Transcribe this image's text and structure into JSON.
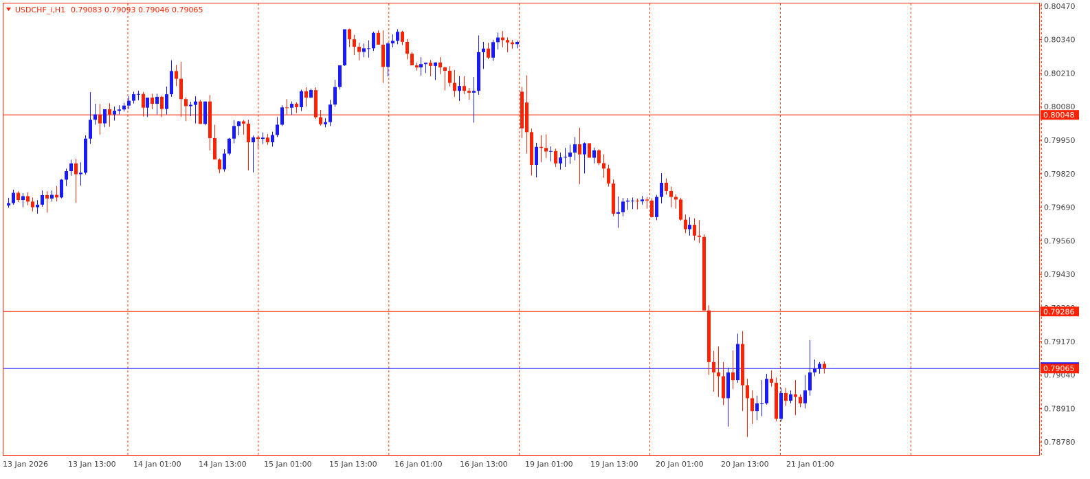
{
  "header": {
    "symbol": "USDCHF_i,H1",
    "ohlc": "0.79083 0.79093 0.79046 0.79065"
  },
  "colors": {
    "frame": "#ff2200",
    "bull": "#1a1aff",
    "bear": "#ff2200",
    "grid": "#ff3300",
    "level_line": "#ff2200",
    "bid_line": "#1a1aff",
    "tag_level": "#ff2200",
    "tag_bid": "#ff2200",
    "background": "#ffffff"
  },
  "chart_data": {
    "type": "candlestick",
    "timeframe": "H1",
    "ylim": [
      0.7873,
      0.8048
    ],
    "y_ticks": [
      "0.80470",
      "0.80340",
      "0.80210",
      "0.80080",
      "0.79950",
      "0.79820",
      "0.79690",
      "0.79560",
      "0.79430",
      "0.79300",
      "0.79170",
      "0.79040",
      "0.78910",
      "0.78780"
    ],
    "x_ticks": [
      "13 Jan 2026",
      "13 Jan 13:00",
      "14 Jan 01:00",
      "14 Jan 13:00",
      "15 Jan 01:00",
      "15 Jan 13:00",
      "16 Jan 01:00",
      "16 Jan 13:00",
      "19 Jan 01:00",
      "19 Jan 13:00",
      "20 Jan 01:00",
      "20 Jan 13:00",
      "21 Jan 01:00"
    ],
    "horizontal_levels": [
      {
        "price": 0.80048,
        "label": "0.80048"
      },
      {
        "price": 0.79286,
        "label": "0.79286"
      }
    ],
    "bid": {
      "price": 0.79065,
      "label": "0.79065"
    },
    "grid": "vertical dashed",
    "candles": [
      [
        0.79697,
        0.79727,
        0.79688,
        0.79706
      ],
      [
        0.79706,
        0.79758,
        0.797,
        0.79746
      ],
      [
        0.79746,
        0.79752,
        0.7971,
        0.79718
      ],
      [
        0.79718,
        0.79745,
        0.7969,
        0.79733
      ],
      [
        0.79733,
        0.79748,
        0.79698,
        0.79712
      ],
      [
        0.79712,
        0.79728,
        0.79674,
        0.7969
      ],
      [
        0.7969,
        0.79718,
        0.79665,
        0.797
      ],
      [
        0.797,
        0.79755,
        0.79692,
        0.79737
      ],
      [
        0.79737,
        0.79752,
        0.79669,
        0.79724
      ],
      [
        0.79724,
        0.79755,
        0.79712,
        0.79738
      ],
      [
        0.79738,
        0.79772,
        0.79713,
        0.79728
      ],
      [
        0.79728,
        0.79799,
        0.79725,
        0.79797
      ],
      [
        0.79797,
        0.7984,
        0.79772,
        0.7983
      ],
      [
        0.7983,
        0.79874,
        0.79812,
        0.7986
      ],
      [
        0.7986,
        0.79878,
        0.79707,
        0.79818
      ],
      [
        0.79818,
        0.79864,
        0.79774,
        0.79824
      ],
      [
        0.79824,
        0.79969,
        0.79817,
        0.79956
      ],
      [
        0.79956,
        0.80136,
        0.79936,
        0.80029
      ],
      [
        0.80029,
        0.80091,
        0.8001,
        0.8005
      ],
      [
        0.8005,
        0.8009,
        0.79972,
        0.80015
      ],
      [
        0.80015,
        0.80061,
        0.8,
        0.8007
      ],
      [
        0.8007,
        0.80093,
        0.80002,
        0.8005
      ],
      [
        0.8005,
        0.8008,
        0.80026,
        0.80064
      ],
      [
        0.80064,
        0.80085,
        0.8005,
        0.80069
      ],
      [
        0.80069,
        0.80095,
        0.80061,
        0.80084
      ],
      [
        0.80084,
        0.8012,
        0.8007,
        0.80103
      ],
      [
        0.80103,
        0.80138,
        0.80092,
        0.80128
      ],
      [
        0.80128,
        0.80142,
        0.80105,
        0.80129
      ],
      [
        0.80129,
        0.80137,
        0.80042,
        0.80076
      ],
      [
        0.80076,
        0.8011,
        0.8004,
        0.80115
      ],
      [
        0.80115,
        0.8013,
        0.8007,
        0.80091
      ],
      [
        0.80091,
        0.8013,
        0.8005,
        0.80118
      ],
      [
        0.80118,
        0.80122,
        0.8004,
        0.80071
      ],
      [
        0.80071,
        0.80158,
        0.8005,
        0.80128
      ],
      [
        0.80128,
        0.8026,
        0.80118,
        0.80218
      ],
      [
        0.80218,
        0.80241,
        0.80159,
        0.80188
      ],
      [
        0.80188,
        0.80254,
        0.80041,
        0.80109
      ],
      [
        0.80109,
        0.80116,
        0.80024,
        0.80082
      ],
      [
        0.80082,
        0.80099,
        0.80043,
        0.80087
      ],
      [
        0.80087,
        0.8012,
        0.80015,
        0.801
      ],
      [
        0.801,
        0.80106,
        0.80028,
        0.80013
      ],
      [
        0.80013,
        0.801,
        0.80008,
        0.801
      ],
      [
        0.801,
        0.80125,
        0.7991,
        0.79958
      ],
      [
        0.79958,
        0.8001,
        0.79921,
        0.79875
      ],
      [
        0.79875,
        0.79879,
        0.79822,
        0.79837
      ],
      [
        0.79837,
        0.79915,
        0.79828,
        0.79898
      ],
      [
        0.79898,
        0.79959,
        0.79891,
        0.79956
      ],
      [
        0.79956,
        0.80028,
        0.79938,
        0.80005
      ],
      [
        0.80005,
        0.80025,
        0.79969,
        0.80023
      ],
      [
        0.80023,
        0.80028,
        0.79972,
        0.80014
      ],
      [
        0.80014,
        0.80029,
        0.79833,
        0.79942
      ],
      [
        0.79942,
        0.79968,
        0.79825,
        0.79961
      ],
      [
        0.79961,
        0.79967,
        0.79917,
        0.79955
      ],
      [
        0.79955,
        0.7998,
        0.79935,
        0.7996
      ],
      [
        0.7996,
        0.79974,
        0.79932,
        0.79942
      ],
      [
        0.79942,
        0.79983,
        0.79925,
        0.7997
      ],
      [
        0.7997,
        0.8004,
        0.79962,
        0.8001
      ],
      [
        0.8001,
        0.80085,
        0.80005,
        0.80077
      ],
      [
        0.80077,
        0.80109,
        0.8005,
        0.80076
      ],
      [
        0.80076,
        0.801,
        0.80048,
        0.80091
      ],
      [
        0.80091,
        0.80097,
        0.80055,
        0.80078
      ],
      [
        0.80078,
        0.80146,
        0.80063,
        0.8014
      ],
      [
        0.8014,
        0.80155,
        0.8008,
        0.80115
      ],
      [
        0.80115,
        0.8015,
        0.80125,
        0.80144
      ],
      [
        0.80144,
        0.80155,
        0.80033,
        0.80039
      ],
      [
        0.80039,
        0.80067,
        0.80007,
        0.80012
      ],
      [
        0.80012,
        0.80036,
        0.8,
        0.8002
      ],
      [
        0.8002,
        0.80106,
        0.80005,
        0.80088
      ],
      [
        0.80088,
        0.80184,
        0.80079,
        0.80156
      ],
      [
        0.80156,
        0.8022,
        0.80146,
        0.8024
      ],
      [
        0.8024,
        0.80348,
        0.80238,
        0.8038
      ],
      [
        0.8038,
        0.80382,
        0.80311,
        0.80341
      ],
      [
        0.80341,
        0.80358,
        0.8028,
        0.80312
      ],
      [
        0.80312,
        0.80328,
        0.8026,
        0.80292
      ],
      [
        0.80292,
        0.80325,
        0.80272,
        0.80306
      ],
      [
        0.80306,
        0.80337,
        0.8027,
        0.80306
      ],
      [
        0.80306,
        0.8037,
        0.80296,
        0.80366
      ],
      [
        0.80366,
        0.80375,
        0.80323,
        0.8032
      ],
      [
        0.8032,
        0.80375,
        0.80172,
        0.80234
      ],
      [
        0.80234,
        0.8033,
        0.80197,
        0.80325
      ],
      [
        0.80325,
        0.8036,
        0.8031,
        0.80335
      ],
      [
        0.80335,
        0.8038,
        0.80322,
        0.8037
      ],
      [
        0.8037,
        0.80374,
        0.80319,
        0.80331
      ],
      [
        0.80331,
        0.80342,
        0.80263,
        0.80285
      ],
      [
        0.80285,
        0.80292,
        0.80241,
        0.8024
      ],
      [
        0.8024,
        0.8025,
        0.8022,
        0.80232
      ],
      [
        0.80232,
        0.80272,
        0.802,
        0.80245
      ],
      [
        0.80245,
        0.8025,
        0.8021,
        0.8025
      ],
      [
        0.8025,
        0.80261,
        0.80198,
        0.80238
      ],
      [
        0.80238,
        0.80252,
        0.80183,
        0.80251
      ],
      [
        0.80251,
        0.80272,
        0.80206,
        0.80232
      ],
      [
        0.80232,
        0.80235,
        0.80143,
        0.80219
      ],
      [
        0.80219,
        0.80237,
        0.80158,
        0.80172
      ],
      [
        0.80172,
        0.80222,
        0.80118,
        0.80141
      ],
      [
        0.80141,
        0.80198,
        0.80102,
        0.8016
      ],
      [
        0.8016,
        0.80198,
        0.80129,
        0.80141
      ],
      [
        0.80141,
        0.80152,
        0.80106,
        0.80134
      ],
      [
        0.80134,
        0.80195,
        0.80018,
        0.80141
      ],
      [
        0.80141,
        0.80356,
        0.80126,
        0.80291
      ],
      [
        0.80291,
        0.80331,
        0.80226,
        0.80305
      ],
      [
        0.80305,
        0.80327,
        0.80264,
        0.8027
      ],
      [
        0.8027,
        0.80339,
        0.80257,
        0.8033
      ],
      [
        0.8033,
        0.80367,
        0.80302,
        0.80348
      ],
      [
        0.80348,
        0.80373,
        0.8031,
        0.80338
      ],
      [
        0.80338,
        0.80348,
        0.80291,
        0.80329
      ],
      [
        0.80329,
        0.80339,
        0.80305,
        0.80322
      ],
      [
        0.80322,
        0.80336,
        0.80306,
        0.80331
      ],
      [
        0.80138,
        0.80157,
        0.79958,
        0.79996
      ],
      [
        0.80096,
        0.80201,
        0.79898,
        0.79981
      ],
      [
        0.79981,
        0.79995,
        0.79813,
        0.79854
      ],
      [
        0.79854,
        0.7994,
        0.79806,
        0.79924
      ],
      [
        0.79924,
        0.79969,
        0.79865,
        0.7992
      ],
      [
        0.7992,
        0.79973,
        0.79881,
        0.79906
      ],
      [
        0.79906,
        0.79926,
        0.79868,
        0.79908
      ],
      [
        0.79908,
        0.79917,
        0.79846,
        0.7986
      ],
      [
        0.7986,
        0.79902,
        0.79836,
        0.79883
      ],
      [
        0.79883,
        0.7992,
        0.79846,
        0.79886
      ],
      [
        0.79886,
        0.79933,
        0.79858,
        0.79902
      ],
      [
        0.79902,
        0.79962,
        0.79872,
        0.79934
      ],
      [
        0.79934,
        0.79998,
        0.7978,
        0.79895
      ],
      [
        0.79895,
        0.79941,
        0.79821,
        0.79938
      ],
      [
        0.79938,
        0.79938,
        0.79883,
        0.79882
      ],
      [
        0.79882,
        0.79921,
        0.7986,
        0.79911
      ],
      [
        0.79911,
        0.79915,
        0.79853,
        0.79861
      ],
      [
        0.79861,
        0.79895,
        0.79804,
        0.7984
      ],
      [
        0.7984,
        0.79855,
        0.7977,
        0.79782
      ],
      [
        0.79782,
        0.79798,
        0.79655,
        0.79665
      ],
      [
        0.79665,
        0.79732,
        0.7961,
        0.79671
      ],
      [
        0.79671,
        0.79726,
        0.79655,
        0.79712
      ],
      [
        0.79712,
        0.79726,
        0.7968,
        0.79716
      ],
      [
        0.79716,
        0.79728,
        0.79683,
        0.79716
      ],
      [
        0.79716,
        0.79724,
        0.79682,
        0.79713
      ],
      [
        0.79713,
        0.79734,
        0.797,
        0.7972
      ],
      [
        0.7972,
        0.7973,
        0.79685,
        0.79716
      ],
      [
        0.79716,
        0.79725,
        0.7965,
        0.79652
      ],
      [
        0.79652,
        0.79738,
        0.7964,
        0.7973
      ],
      [
        0.7973,
        0.79822,
        0.79705,
        0.79785
      ],
      [
        0.79785,
        0.79802,
        0.79739,
        0.79753
      ],
      [
        0.79753,
        0.7977,
        0.7969,
        0.7973
      ],
      [
        0.7973,
        0.7974,
        0.79685,
        0.7972
      ],
      [
        0.7972,
        0.79727,
        0.79638,
        0.79642
      ],
      [
        0.79642,
        0.79662,
        0.7959,
        0.79605
      ],
      [
        0.79605,
        0.79652,
        0.7958,
        0.79622
      ],
      [
        0.79622,
        0.79647,
        0.79562,
        0.7958
      ],
      [
        0.7958,
        0.7964,
        0.79551,
        0.79575
      ],
      [
        0.79575,
        0.79585,
        0.79305,
        0.7929
      ],
      [
        0.7929,
        0.7931,
        0.7904,
        0.7909
      ],
      [
        0.7909,
        0.79133,
        0.78975,
        0.7905
      ],
      [
        0.7905,
        0.7915,
        0.78955,
        0.79035
      ],
      [
        0.79035,
        0.7909,
        0.78923,
        0.7895
      ],
      [
        0.7895,
        0.79068,
        0.7884,
        0.7905
      ],
      [
        0.7905,
        0.79135,
        0.78985,
        0.7902
      ],
      [
        0.7902,
        0.792,
        0.7901,
        0.7916
      ],
      [
        0.7916,
        0.7921,
        0.789,
        0.79
      ],
      [
        0.79,
        0.79025,
        0.788,
        0.7895
      ],
      [
        0.7895,
        0.7898,
        0.7885,
        0.789
      ],
      [
        0.789,
        0.7896,
        0.78865,
        0.7893
      ],
      [
        0.7893,
        0.7902,
        0.7888,
        0.7893
      ],
      [
        0.7893,
        0.79045,
        0.78925,
        0.79025
      ],
      [
        0.79025,
        0.79058,
        0.78995,
        0.7901
      ],
      [
        0.7901,
        0.7903,
        0.7886,
        0.7887
      ],
      [
        0.7887,
        0.7899,
        0.7886,
        0.7897
      ],
      [
        0.7897,
        0.7899,
        0.7892,
        0.7894
      ],
      [
        0.7894,
        0.7898,
        0.7893,
        0.78965
      ],
      [
        0.78965,
        0.7902,
        0.78885,
        0.78955
      ],
      [
        0.78955,
        0.78965,
        0.78915,
        0.7893
      ],
      [
        0.7893,
        0.7904,
        0.7891,
        0.7898
      ],
      [
        0.7898,
        0.79175,
        0.7896,
        0.7905
      ],
      [
        0.7905,
        0.791,
        0.79035,
        0.79064
      ],
      [
        0.79064,
        0.7909,
        0.79045,
        0.79083
      ],
      [
        0.79083,
        0.79093,
        0.79046,
        0.79065
      ]
    ]
  }
}
